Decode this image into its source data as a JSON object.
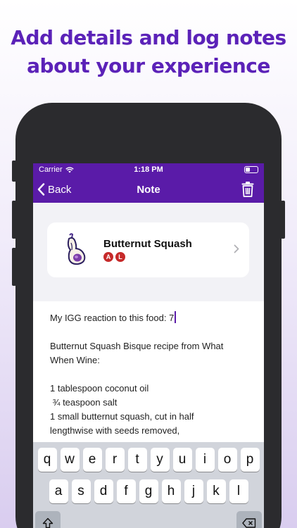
{
  "headline": {
    "line1": "Add details and log notes",
    "line2": "about your experience"
  },
  "status_bar": {
    "carrier": "Carrier",
    "time": "1:18 PM"
  },
  "nav": {
    "back_label": "Back",
    "title": "Note"
  },
  "food_card": {
    "name": "Butternut Squash",
    "badges": [
      "A",
      "L"
    ]
  },
  "note": {
    "lines": [
      "My IGG reaction to this food: 7",
      "",
      "Butternut Squash Bisque recipe from What",
      "When Wine:",
      "",
      "1 tablespoon coconut oil",
      " ¾ teaspoon salt",
      "1 small butternut squash, cut in half",
      "lengthwise with seeds removed,"
    ]
  },
  "keyboard": {
    "row1": [
      "q",
      "w",
      "e",
      "r",
      "t",
      "y",
      "u",
      "i",
      "o",
      "p"
    ],
    "row2": [
      "a",
      "s",
      "d",
      "f",
      "g",
      "h",
      "j",
      "k",
      "l"
    ]
  },
  "colors": {
    "brand_purple": "#5a1ba8",
    "headline_purple": "#5b22b8",
    "badge_red": "#c62a2a"
  },
  "icons": [
    "wifi-icon",
    "battery-icon",
    "back-chevron-icon",
    "trash-icon",
    "butternut-squash-icon",
    "chevron-right-icon",
    "shift-icon",
    "delete-icon"
  ]
}
